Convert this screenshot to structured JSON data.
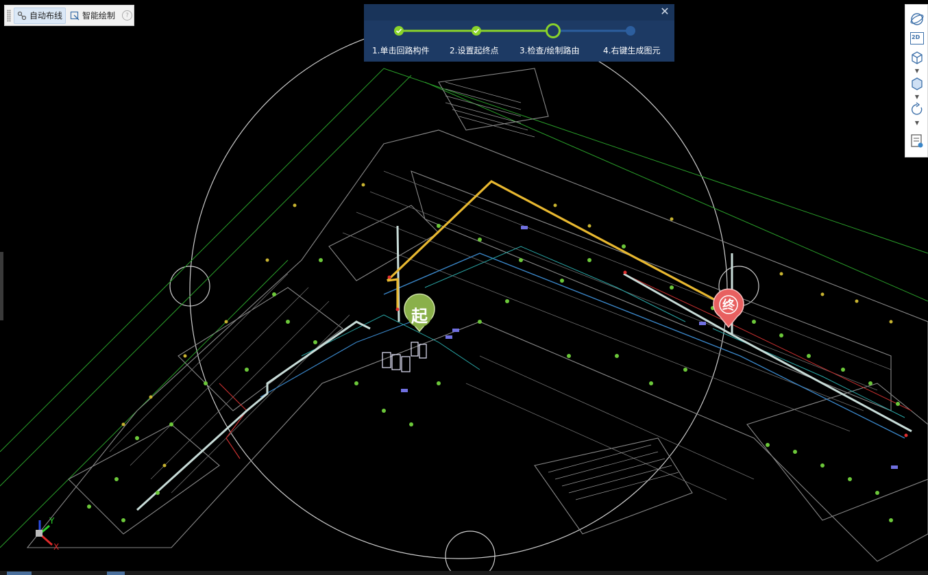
{
  "toolbar": {
    "auto_route_label": "自动布线",
    "smart_draw_label": "智能绘制",
    "help_icon": "?"
  },
  "stepper": {
    "close_glyph": "✕",
    "steps": [
      {
        "label": "1.单击回路构件",
        "state": "done"
      },
      {
        "label": "2.设置起终点",
        "state": "done"
      },
      {
        "label": "3.检查/绘制路由",
        "state": "current"
      },
      {
        "label": "4.右键生成图元",
        "state": "pending"
      }
    ],
    "colors": {
      "done": "#8ad32a",
      "pending": "#2c5e9e",
      "panel": "#1d3a64"
    }
  },
  "markers": {
    "start_label": "起",
    "end_label": "终",
    "start_color": "#8ab04a",
    "end_color": "#e86060"
  },
  "route": {
    "color": "#e8b830"
  },
  "axes": {
    "y_label": "Y",
    "x_label": "X"
  },
  "right_toolbar": {
    "buttons": [
      "orbit-icon",
      "view-2d-icon",
      "cube-icon",
      "box-icon",
      "rotate-icon",
      "layer-list-icon"
    ],
    "view_2d_text": "2D"
  }
}
